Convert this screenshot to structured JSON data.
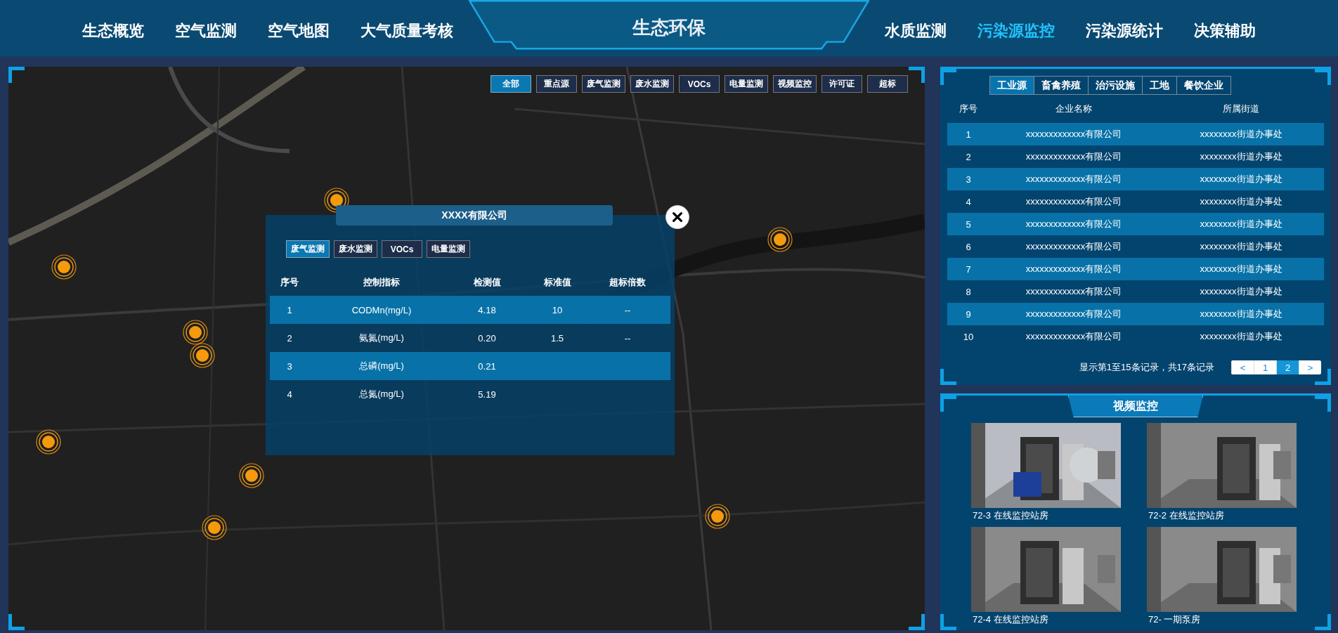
{
  "header": {
    "title": "生态环保",
    "nav_left": [
      {
        "label": "生态概览",
        "selected": false
      },
      {
        "label": "空气监测",
        "selected": false
      },
      {
        "label": "空气地图",
        "selected": false
      },
      {
        "label": "大气质量考核",
        "selected": false
      }
    ],
    "nav_right": [
      {
        "label": "水质监测",
        "selected": false
      },
      {
        "label": "污染源监控",
        "selected": true
      },
      {
        "label": "污染源统计",
        "selected": false
      },
      {
        "label": "决策辅助",
        "selected": false
      }
    ]
  },
  "map": {
    "filters": [
      {
        "label": "全部",
        "selected": true
      },
      {
        "label": "重点源",
        "selected": false
      },
      {
        "label": "废气监测",
        "selected": false
      },
      {
        "label": "废水监测",
        "selected": false
      },
      {
        "label": "VOCs",
        "selected": false
      },
      {
        "label": "电量监测",
        "selected": false
      },
      {
        "label": "视频监控",
        "selected": false
      },
      {
        "label": "许可证",
        "selected": false
      },
      {
        "label": "超标",
        "selected": false
      }
    ]
  },
  "popup": {
    "title": "XXXX有限公司",
    "tabs": [
      {
        "label": "废气监测",
        "selected": true
      },
      {
        "label": "废水监测",
        "selected": false
      },
      {
        "label": "VOCs",
        "selected": false
      },
      {
        "label": "电量监测",
        "selected": false
      }
    ],
    "columns": [
      "序号",
      "控制指标",
      "检测值",
      "标准值",
      "超标倍数"
    ],
    "rows": [
      {
        "cells": [
          "1",
          "CODMn(mg/L)",
          "4.18",
          "10",
          "--"
        ]
      },
      {
        "cells": [
          "2",
          "氨氮(mg/L)",
          "0.20",
          "1.5",
          "--"
        ]
      },
      {
        "cells": [
          "3",
          "总磷(mg/L)",
          "0.21"
        ]
      },
      {
        "cells": [
          "4",
          "总氮(mg/L)",
          "5.19"
        ]
      }
    ]
  },
  "sources": {
    "tabs": [
      {
        "label": "工业源",
        "selected": true
      },
      {
        "label": "畜禽养殖",
        "selected": false
      },
      {
        "label": "治污设施",
        "selected": false
      },
      {
        "label": "工地",
        "selected": false
      },
      {
        "label": "餐饮企业",
        "selected": false
      }
    ],
    "columns": [
      "序号",
      "企业名称",
      "所属街道"
    ],
    "rows": [
      {
        "cells": [
          "1",
          "xxxxxxxxxxxxx有限公司",
          "xxxxxxxx街道办事处"
        ]
      },
      {
        "cells": [
          "2",
          "xxxxxxxxxxxxx有限公司",
          "xxxxxxxx街道办事处"
        ]
      },
      {
        "cells": [
          "3",
          "xxxxxxxxxxxxx有限公司",
          "xxxxxxxx街道办事处"
        ]
      },
      {
        "cells": [
          "4",
          "xxxxxxxxxxxxx有限公司",
          "xxxxxxxx街道办事处"
        ]
      },
      {
        "cells": [
          "5",
          "xxxxxxxxxxxxx有限公司",
          "xxxxxxxx街道办事处"
        ]
      },
      {
        "cells": [
          "6",
          "xxxxxxxxxxxxx有限公司",
          "xxxxxxxx街道办事处"
        ]
      },
      {
        "cells": [
          "7",
          "xxxxxxxxxxxxx有限公司",
          "xxxxxxxx街道办事处"
        ]
      },
      {
        "cells": [
          "8",
          "xxxxxxxxxxxxx有限公司",
          "xxxxxxxx街道办事处"
        ]
      },
      {
        "cells": [
          "9",
          "xxxxxxxxxxxxx有限公司",
          "xxxxxxxx街道办事处"
        ]
      },
      {
        "cells": [
          "10",
          "xxxxxxxxxxxxx有限公司",
          "xxxxxxxx街道办事处"
        ]
      }
    ],
    "pagination": {
      "summary": "显示第1至15条记录，共17条记录",
      "prev": "<",
      "pages": [
        {
          "label": "1",
          "selected": false
        },
        {
          "label": "2",
          "selected": true
        }
      ],
      "next": ">"
    }
  },
  "video": {
    "title": "视频监控",
    "feeds": [
      {
        "caption": "72-3 在线监控站房"
      },
      {
        "caption": "72-2 在线监控站房"
      },
      {
        "caption": "72-4 在线监控站房"
      },
      {
        "caption": "72- 一期泵房"
      }
    ]
  }
}
